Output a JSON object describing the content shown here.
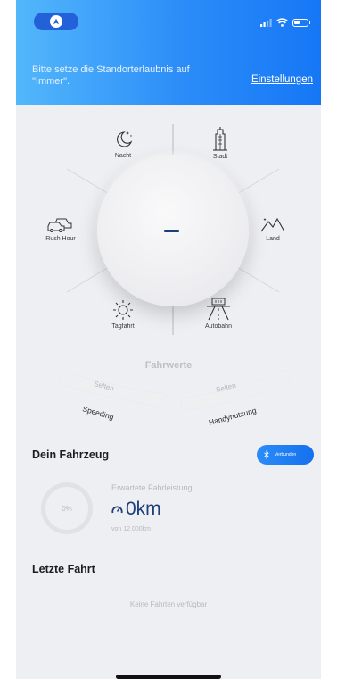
{
  "status_bar": {
    "app_icon": "navigation-arrow-icon",
    "signal_icon": "signal-bars-icon",
    "wifi_icon": "wifi-icon",
    "battery_icon": "battery-icon"
  },
  "permission_banner": {
    "message": "Bitte setze die Standorterlaubnis auf \"Immer\".",
    "link": "Einstellungen"
  },
  "driving_wheel": {
    "center_value": "–",
    "categories": [
      {
        "label": "Nacht",
        "icon": "moon-stars-icon"
      },
      {
        "label": "Stadt",
        "icon": "skyscraper-icon"
      },
      {
        "label": "Rush Hour",
        "icon": "traffic-jam-icon"
      },
      {
        "label": "Land",
        "icon": "mountains-icon"
      },
      {
        "label": "Tagfahrt",
        "icon": "sun-icon"
      },
      {
        "label": "Autobahn",
        "icon": "highway-icon"
      }
    ]
  },
  "driving_values": {
    "title": "Fahrwerte",
    "left": {
      "frequency": "Selten",
      "label": "Speeding"
    },
    "right": {
      "frequency": "Selten",
      "label": "Handynutzung"
    }
  },
  "vehicle": {
    "title": "Dein Fahrzeug",
    "connect_button": "Verbunden",
    "connect_icon": "bluetooth-icon",
    "progress_percent": "0%",
    "progress_value": 0,
    "expected_label": "Erwartete Fahrleistung",
    "km_value": "0km",
    "km_icon": "gauge-icon",
    "of_total": "von 12.000km"
  },
  "last_trip": {
    "title": "Letzte Fahrt",
    "empty_message": "Keine Fahrten verfügbar"
  },
  "colors": {
    "accent": "#1677f6",
    "dark_blue": "#1b3d79",
    "background": "#eeeff2"
  }
}
